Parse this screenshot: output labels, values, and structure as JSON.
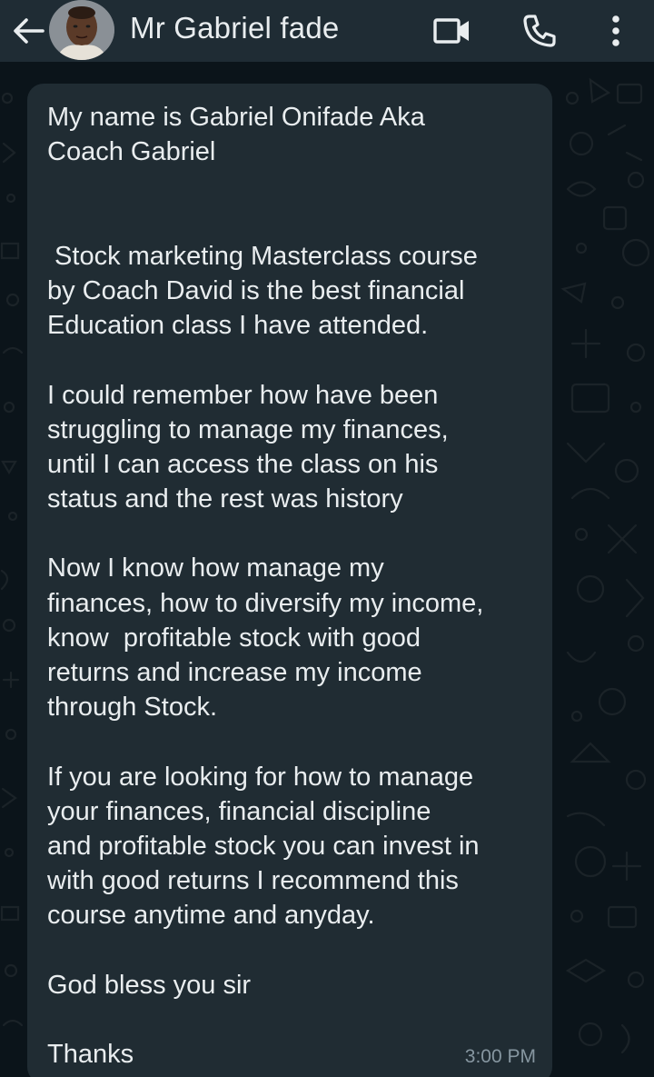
{
  "header": {
    "contact_name": "Mr Gabriel fade",
    "back_icon": "arrow-left-icon",
    "video_icon": "video-camera-icon",
    "call_icon": "phone-icon",
    "menu_icon": "more-vertical-icon"
  },
  "message": {
    "lines": [
      "My name is Gabriel Onifade Aka",
      "Coach Gabriel",
      "",
      "",
      " Stock marketing Masterclass course",
      "by Coach David is the best financial",
      "Education class I have attended.",
      "",
      "I could remember how have been",
      "struggling to manage my finances,",
      "until I can access the class on his",
      "status and the rest was history",
      "",
      "Now I know how manage my",
      "finances, how to diversify my income,",
      "know  profitable stock with good",
      "returns and increase my income",
      "through Stock.",
      "",
      "If you are looking for how to manage",
      "your finances, financial discipline",
      "and profitable stock you can invest in",
      "with good returns I recommend this",
      "course anytime and anyday.",
      "",
      "God bless you sir",
      "",
      "Thanks"
    ],
    "time": "3:00 PM"
  },
  "colors": {
    "header_bg": "#1f2c34",
    "chat_bg": "#0b141a",
    "bubble_bg": "#202c33",
    "text": "#e9edef",
    "meta_text": "#8696a0"
  }
}
